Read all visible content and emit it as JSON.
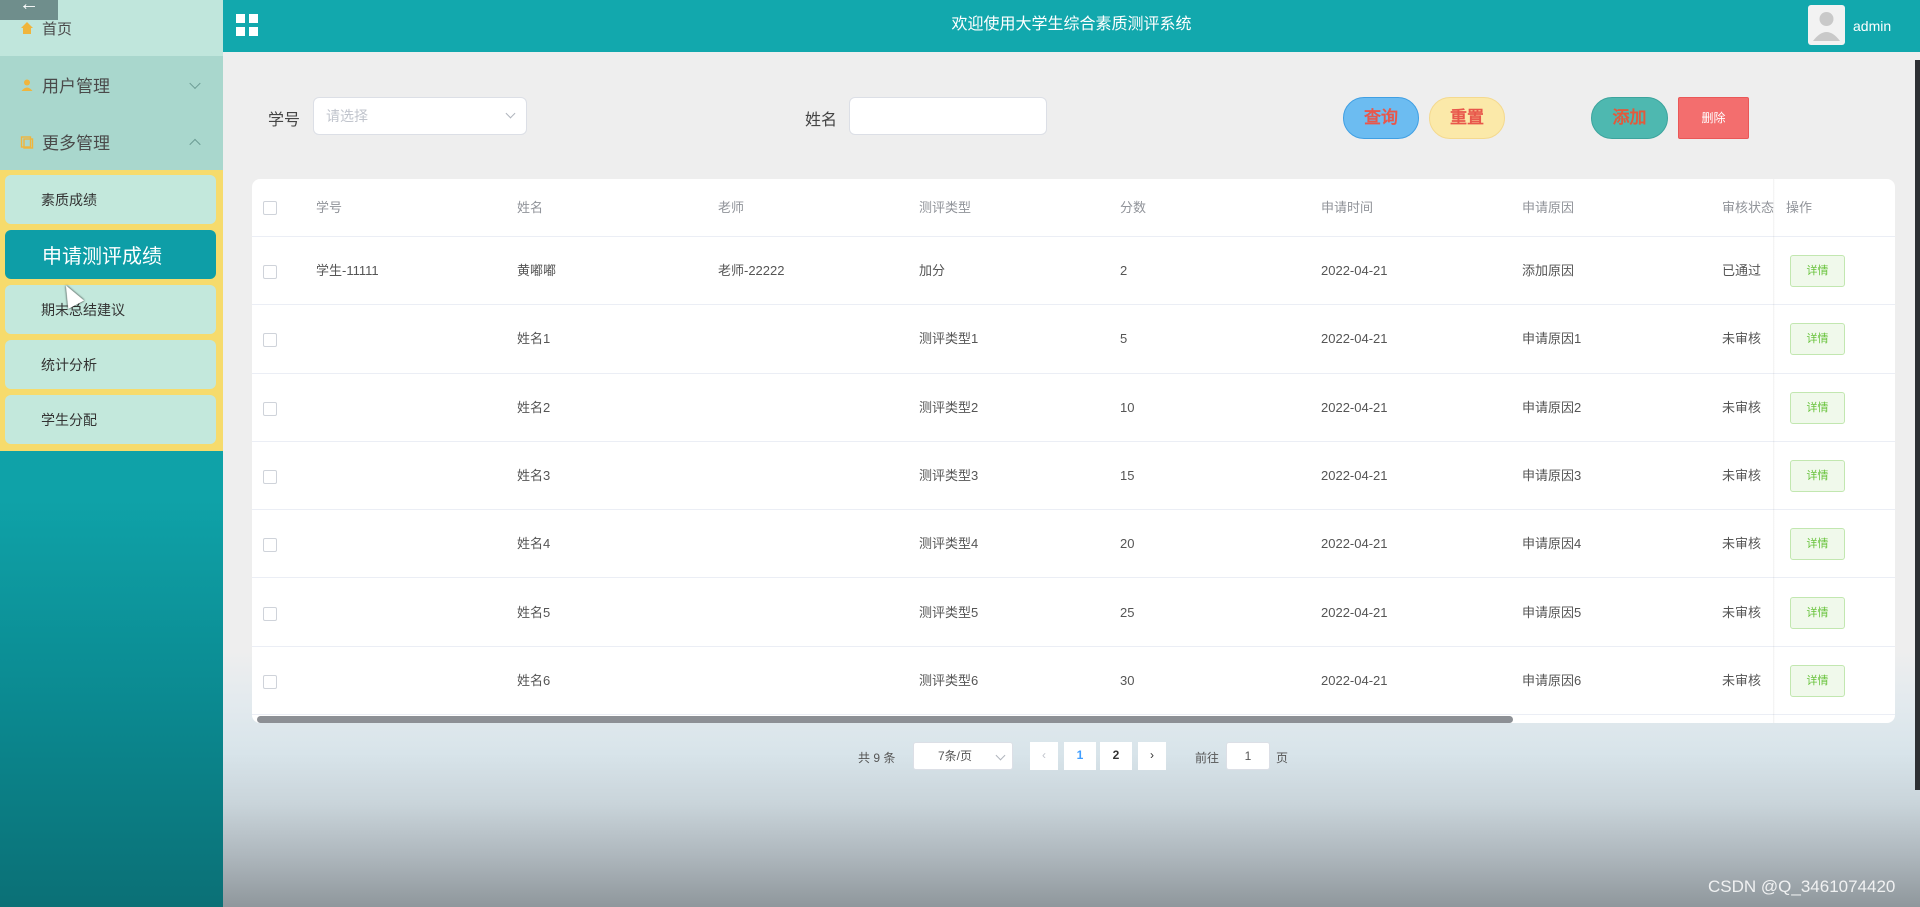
{
  "back_icon": "arrow-left-icon",
  "header": {
    "title": "欢迎使用大学生综合素质测评系统",
    "username": "admin"
  },
  "sidebar": {
    "home": "首页",
    "user_mgmt": "用户管理",
    "more_mgmt": "更多管理",
    "sub_items": [
      "素质成绩",
      "申请测评成绩",
      "期末总结建议",
      "统计分析",
      "学生分配"
    ]
  },
  "search": {
    "student_id_label": "学号",
    "student_id_placeholder": "请选择",
    "name_label": "姓名",
    "name_value": "",
    "query": "查询",
    "reset": "重置",
    "add": "添加",
    "delete": "删除"
  },
  "table": {
    "headers": [
      "学号",
      "姓名",
      "老师",
      "测评类型",
      "分数",
      "申请时间",
      "申请原因",
      "审核状态",
      "操作"
    ],
    "detail_label": "详情",
    "rows": [
      [
        "学生-11111",
        "黄嘟嘟",
        "老师-22222",
        "加分",
        "2",
        "2022-04-21",
        "添加原因",
        "已通过"
      ],
      [
        "",
        "姓名1",
        "",
        "测评类型1",
        "5",
        "2022-04-21",
        "申请原因1",
        "未审核"
      ],
      [
        "",
        "姓名2",
        "",
        "测评类型2",
        "10",
        "2022-04-21",
        "申请原因2",
        "未审核"
      ],
      [
        "",
        "姓名3",
        "",
        "测评类型3",
        "15",
        "2022-04-21",
        "申请原因3",
        "未审核"
      ],
      [
        "",
        "姓名4",
        "",
        "测评类型4",
        "20",
        "2022-04-21",
        "申请原因4",
        "未审核"
      ],
      [
        "",
        "姓名5",
        "",
        "测评类型5",
        "25",
        "2022-04-21",
        "申请原因5",
        "未审核"
      ],
      [
        "",
        "姓名6",
        "",
        "测评类型6",
        "30",
        "2022-04-21",
        "申请原因6",
        "未审核"
      ]
    ]
  },
  "pagination": {
    "total": "共 9 条",
    "page_size": "7条/页",
    "pages": [
      "1",
      "2"
    ],
    "goto_prefix": "前往",
    "goto_value": "1",
    "goto_suffix": "页"
  },
  "watermark": "CSDN @Q_3461074420",
  "colors": {
    "primary": "#12a8ad",
    "submenu_bg": "#f6db6c",
    "danger": "#f36e6e"
  }
}
